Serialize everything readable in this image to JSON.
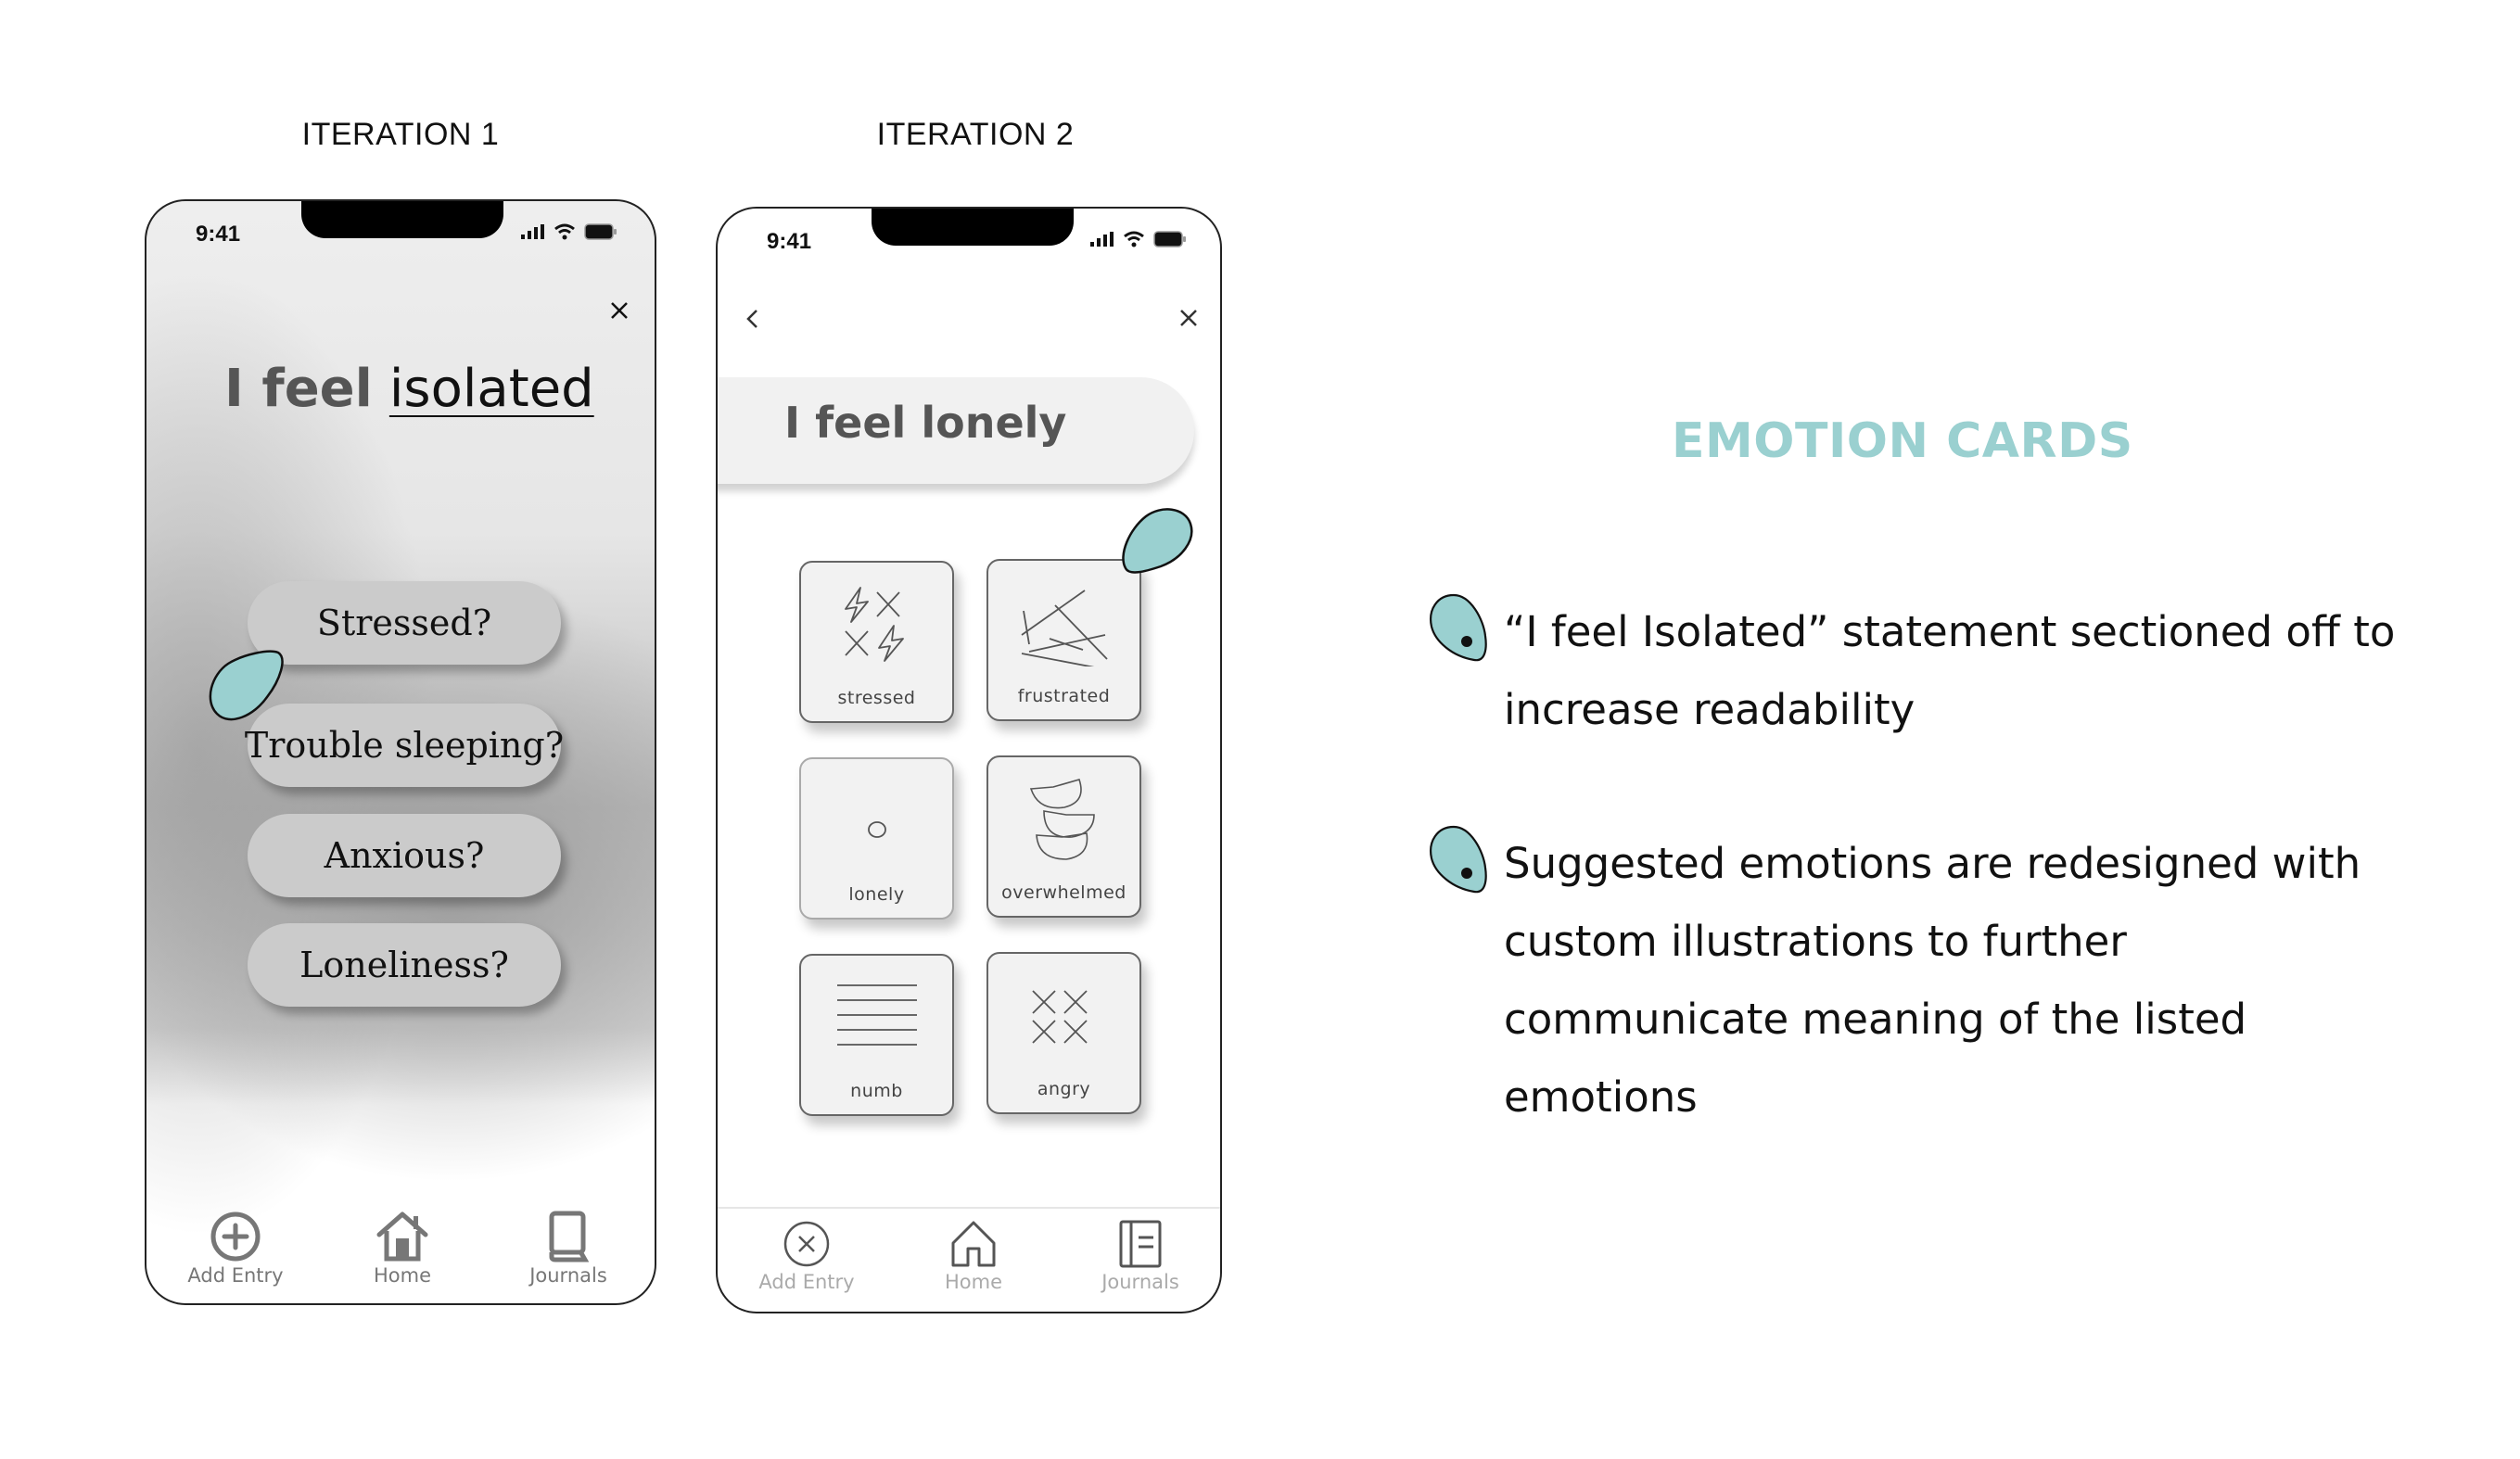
{
  "iterations": [
    {
      "label": "ITERATION 1"
    },
    {
      "label": "ITERATION 2"
    }
  ],
  "phone1": {
    "status_time": "9:41",
    "close_icon": "close-icon",
    "headline_lead": "I feel",
    "headline_word": "isolated",
    "suggestions": [
      "Stressed?",
      "Trouble sleeping?",
      "Anxious?",
      "Loneliness?"
    ],
    "tabs": [
      {
        "label": "Add Entry",
        "icon": "add-circle-icon"
      },
      {
        "label": "Home",
        "icon": "home-icon"
      },
      {
        "label": "Journals",
        "icon": "book-icon"
      }
    ]
  },
  "phone2": {
    "status_time": "9:41",
    "back_icon": "chevron-left-icon",
    "close_icon": "close-icon",
    "header_text": "I feel lonely",
    "cards": [
      {
        "label": "stressed",
        "icon": "lightning-cross-icon"
      },
      {
        "label": "frustrated",
        "icon": "tangled-lines-icon"
      },
      {
        "label": "lonely",
        "icon": "small-circle-icon",
        "selected": true
      },
      {
        "label": "overwhelmed",
        "icon": "stacked-bowls-icon"
      },
      {
        "label": "numb",
        "icon": "flat-lines-icon"
      },
      {
        "label": "angry",
        "icon": "crosses-icon"
      }
    ],
    "tabs": [
      {
        "label": "Add Entry",
        "icon": "close-circle-icon"
      },
      {
        "label": "Home",
        "icon": "home-icon"
      },
      {
        "label": "Journals",
        "icon": "journal-icon"
      }
    ]
  },
  "panel": {
    "title": "EMOTION CARDS",
    "bullets": [
      "“I feel Isolated” statement sectioned off to increase readability",
      "Suggested emotions are redesigned with custom illustrations to further communicate meaning of the listed emotions"
    ]
  },
  "colors": {
    "accent_teal": "#9ad0d0",
    "pill_gray": "#cbcbcb",
    "card_bg": "#f2f2f2",
    "header_bg": "#f1f1f1"
  }
}
